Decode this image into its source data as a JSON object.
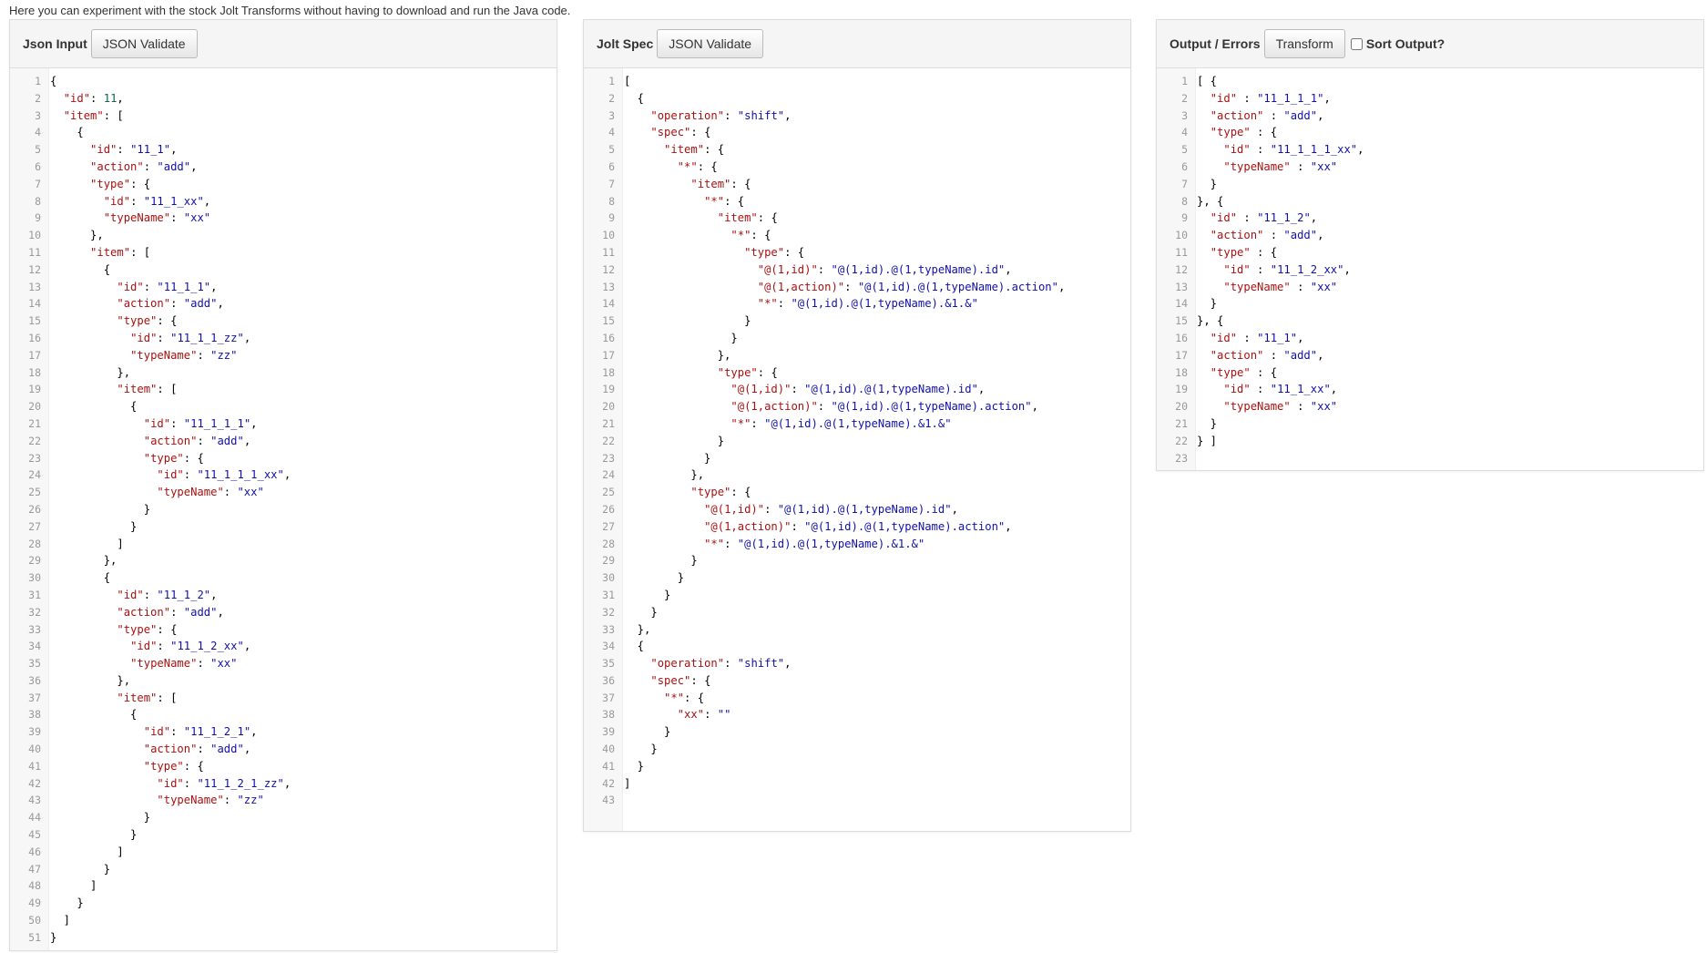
{
  "intro_text": "Here you can experiment with the stock Jolt Transforms without having to download and run the Java code.",
  "panels": {
    "input": {
      "title": "Json Input",
      "button": "JSON Validate",
      "lines": [
        "{",
        "  \"id\": 11,",
        "  \"item\": [",
        "    {",
        "      \"id\": \"11_1\",",
        "      \"action\": \"add\",",
        "      \"type\": {",
        "        \"id\": \"11_1_xx\",",
        "        \"typeName\": \"xx\"",
        "      },",
        "      \"item\": [",
        "        {",
        "          \"id\": \"11_1_1\",",
        "          \"action\": \"add\",",
        "          \"type\": {",
        "            \"id\": \"11_1_1_zz\",",
        "            \"typeName\": \"zz\"",
        "          },",
        "          \"item\": [",
        "            {",
        "              \"id\": \"11_1_1_1\",",
        "              \"action\": \"add\",",
        "              \"type\": {",
        "                \"id\": \"11_1_1_1_xx\",",
        "                \"typeName\": \"xx\"",
        "              }",
        "            }",
        "          ]",
        "        },",
        "        {",
        "          \"id\": \"11_1_2\",",
        "          \"action\": \"add\",",
        "          \"type\": {",
        "            \"id\": \"11_1_2_xx\",",
        "            \"typeName\": \"xx\"",
        "          },",
        "          \"item\": [",
        "            {",
        "              \"id\": \"11_1_2_1\",",
        "              \"action\": \"add\",",
        "              \"type\": {",
        "                \"id\": \"11_1_2_1_zz\",",
        "                \"typeName\": \"zz\"",
        "              }",
        "            }",
        "          ]",
        "        }",
        "      ]",
        "    }",
        "  ]",
        "}"
      ]
    },
    "spec": {
      "title": "Jolt Spec",
      "button": "JSON Validate",
      "lines": [
        "[",
        "  {",
        "    \"operation\": \"shift\",",
        "    \"spec\": {",
        "      \"item\": {",
        "        \"*\": {",
        "          \"item\": {",
        "            \"*\": {",
        "              \"item\": {",
        "                \"*\": {",
        "                  \"type\": {",
        "                    \"@(1,id)\": \"@(1,id).@(1,typeName).id\",",
        "                    \"@(1,action)\": \"@(1,id).@(1,typeName).action\",",
        "                    \"*\": \"@(1,id).@(1,typeName).&1.&\"",
        "                  }",
        "                }",
        "              },",
        "              \"type\": {",
        "                \"@(1,id)\": \"@(1,id).@(1,typeName).id\",",
        "                \"@(1,action)\": \"@(1,id).@(1,typeName).action\",",
        "                \"*\": \"@(1,id).@(1,typeName).&1.&\"",
        "              }",
        "            }",
        "          },",
        "          \"type\": {",
        "            \"@(1,id)\": \"@(1,id).@(1,typeName).id\",",
        "            \"@(1,action)\": \"@(1,id).@(1,typeName).action\",",
        "            \"*\": \"@(1,id).@(1,typeName).&1.&\"",
        "          }",
        "        }",
        "      }",
        "    }",
        "  },",
        "  {",
        "    \"operation\": \"shift\",",
        "    \"spec\": {",
        "      \"*\": {",
        "        \"xx\": \"\"",
        "      }",
        "    }",
        "  }",
        "]",
        ""
      ]
    },
    "output": {
      "title": "Output / Errors",
      "button": "Transform",
      "sort_label": "Sort Output?",
      "lines": [
        "[ {",
        "  \"id\" : \"11_1_1_1\",",
        "  \"action\" : \"add\",",
        "  \"type\" : {",
        "    \"id\" : \"11_1_1_1_xx\",",
        "    \"typeName\" : \"xx\"",
        "  }",
        "}, {",
        "  \"id\" : \"11_1_2\",",
        "  \"action\" : \"add\",",
        "  \"type\" : {",
        "    \"id\" : \"11_1_2_xx\",",
        "    \"typeName\" : \"xx\"",
        "  }",
        "}, {",
        "  \"id\" : \"11_1\",",
        "  \"action\" : \"add\",",
        "  \"type\" : {",
        "    \"id\" : \"11_1_xx\",",
        "    \"typeName\" : \"xx\"",
        "  }",
        "} ]",
        ""
      ]
    }
  }
}
